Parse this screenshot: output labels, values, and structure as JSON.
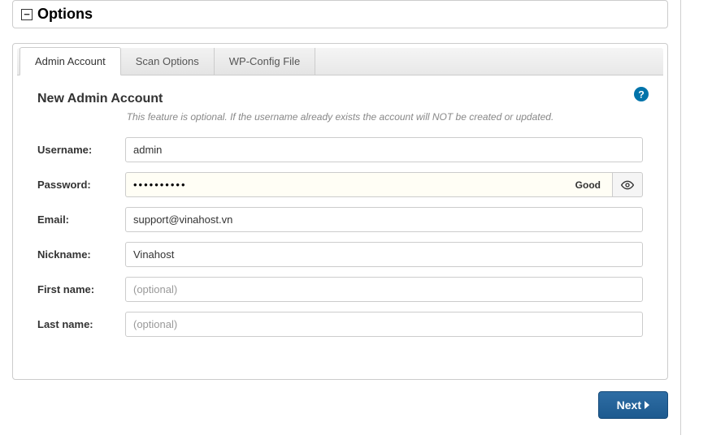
{
  "panel": {
    "title": "Options"
  },
  "tabs": [
    {
      "label": "Admin Account",
      "active": true
    },
    {
      "label": "Scan Options",
      "active": false
    },
    {
      "label": "WP-Config File",
      "active": false
    }
  ],
  "section": {
    "title": "New Admin Account",
    "note": "This feature is optional. If the username already exists the account will NOT be created or updated."
  },
  "form": {
    "username": {
      "label": "Username:",
      "value": "admin"
    },
    "password": {
      "label": "Password:",
      "value": "••••••••••",
      "strength": "Good"
    },
    "email": {
      "label": "Email:",
      "value": "support@vinahost.vn"
    },
    "nickname": {
      "label": "Nickname:",
      "value": "Vinahost"
    },
    "firstname": {
      "label": "First name:",
      "value": "",
      "placeholder": "(optional)"
    },
    "lastname": {
      "label": "Last name:",
      "value": "",
      "placeholder": "(optional)"
    }
  },
  "buttons": {
    "next": "Next"
  }
}
